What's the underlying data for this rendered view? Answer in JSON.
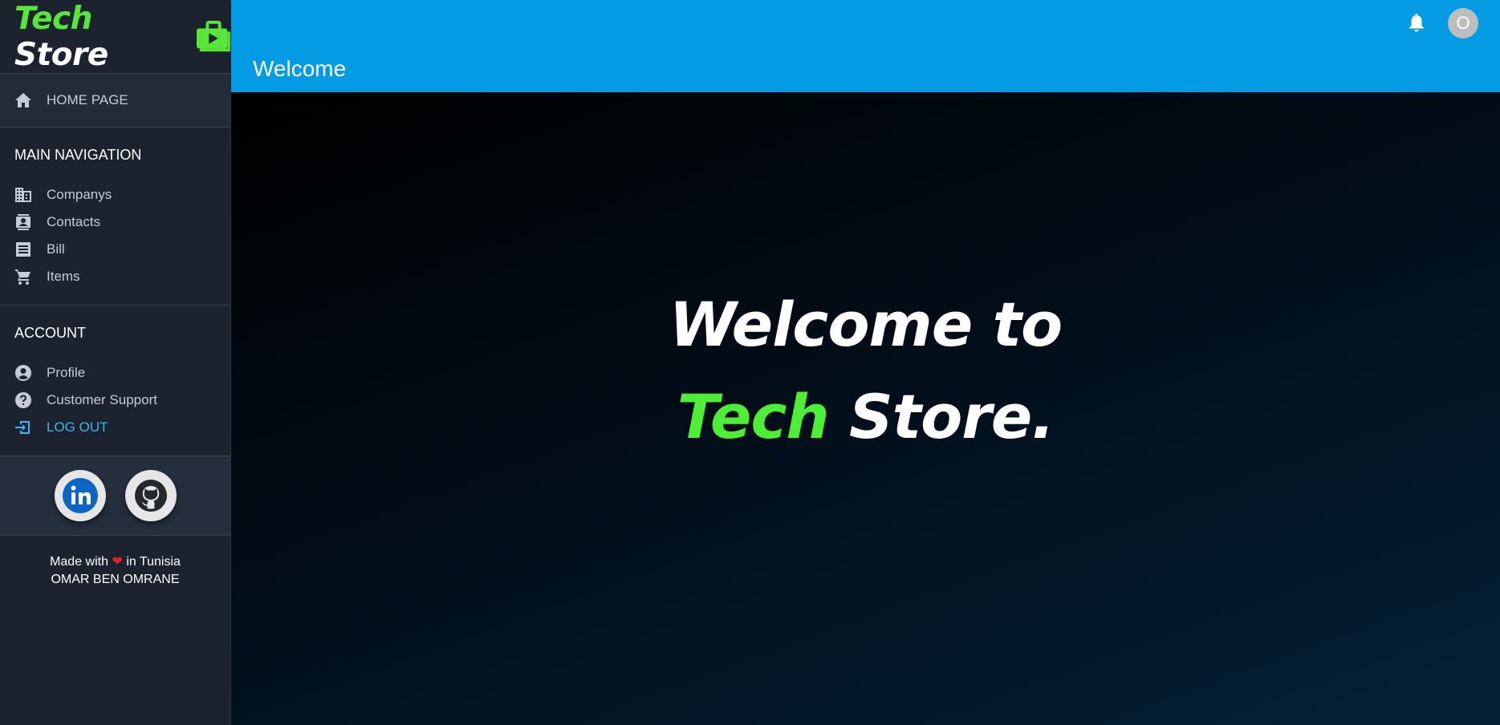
{
  "brand": {
    "tech": "Tech",
    "store": "Store",
    "logo_icon": "shopping-bag-play-icon"
  },
  "sidebar": {
    "home": {
      "label": "HOME PAGE",
      "icon": "home-icon"
    },
    "main_nav": {
      "title": "MAIN NAVIGATION",
      "items": [
        {
          "label": "Companys",
          "icon": "building-icon"
        },
        {
          "label": "Contacts",
          "icon": "contact-card-icon"
        },
        {
          "label": "Bill",
          "icon": "receipt-icon"
        },
        {
          "label": "Items",
          "icon": "cart-icon"
        }
      ]
    },
    "account": {
      "title": "ACCOUNT",
      "items": [
        {
          "label": "Profile",
          "icon": "account-circle-icon"
        },
        {
          "label": "Customer Support",
          "icon": "help-circle-icon"
        },
        {
          "label": "LOG OUT",
          "icon": "logout-icon"
        }
      ]
    },
    "social": [
      {
        "name": "linkedin",
        "icon": "linkedin-icon"
      },
      {
        "name": "github",
        "icon": "github-icon"
      }
    ],
    "footer": {
      "made_with": "Made with",
      "in_country": "in Tunisia",
      "author": "OMAR BEN OMRANE"
    }
  },
  "header": {
    "title": "Welcome",
    "avatar_initial": "O"
  },
  "hero": {
    "line1": "Welcome to",
    "tech": "Tech",
    "store": "Store."
  },
  "colors": {
    "accent_blue": "#049be5",
    "brand_green": "#58e63a",
    "logout_blue": "#3fb6f0",
    "sidebar_bg": "#1c222e"
  }
}
